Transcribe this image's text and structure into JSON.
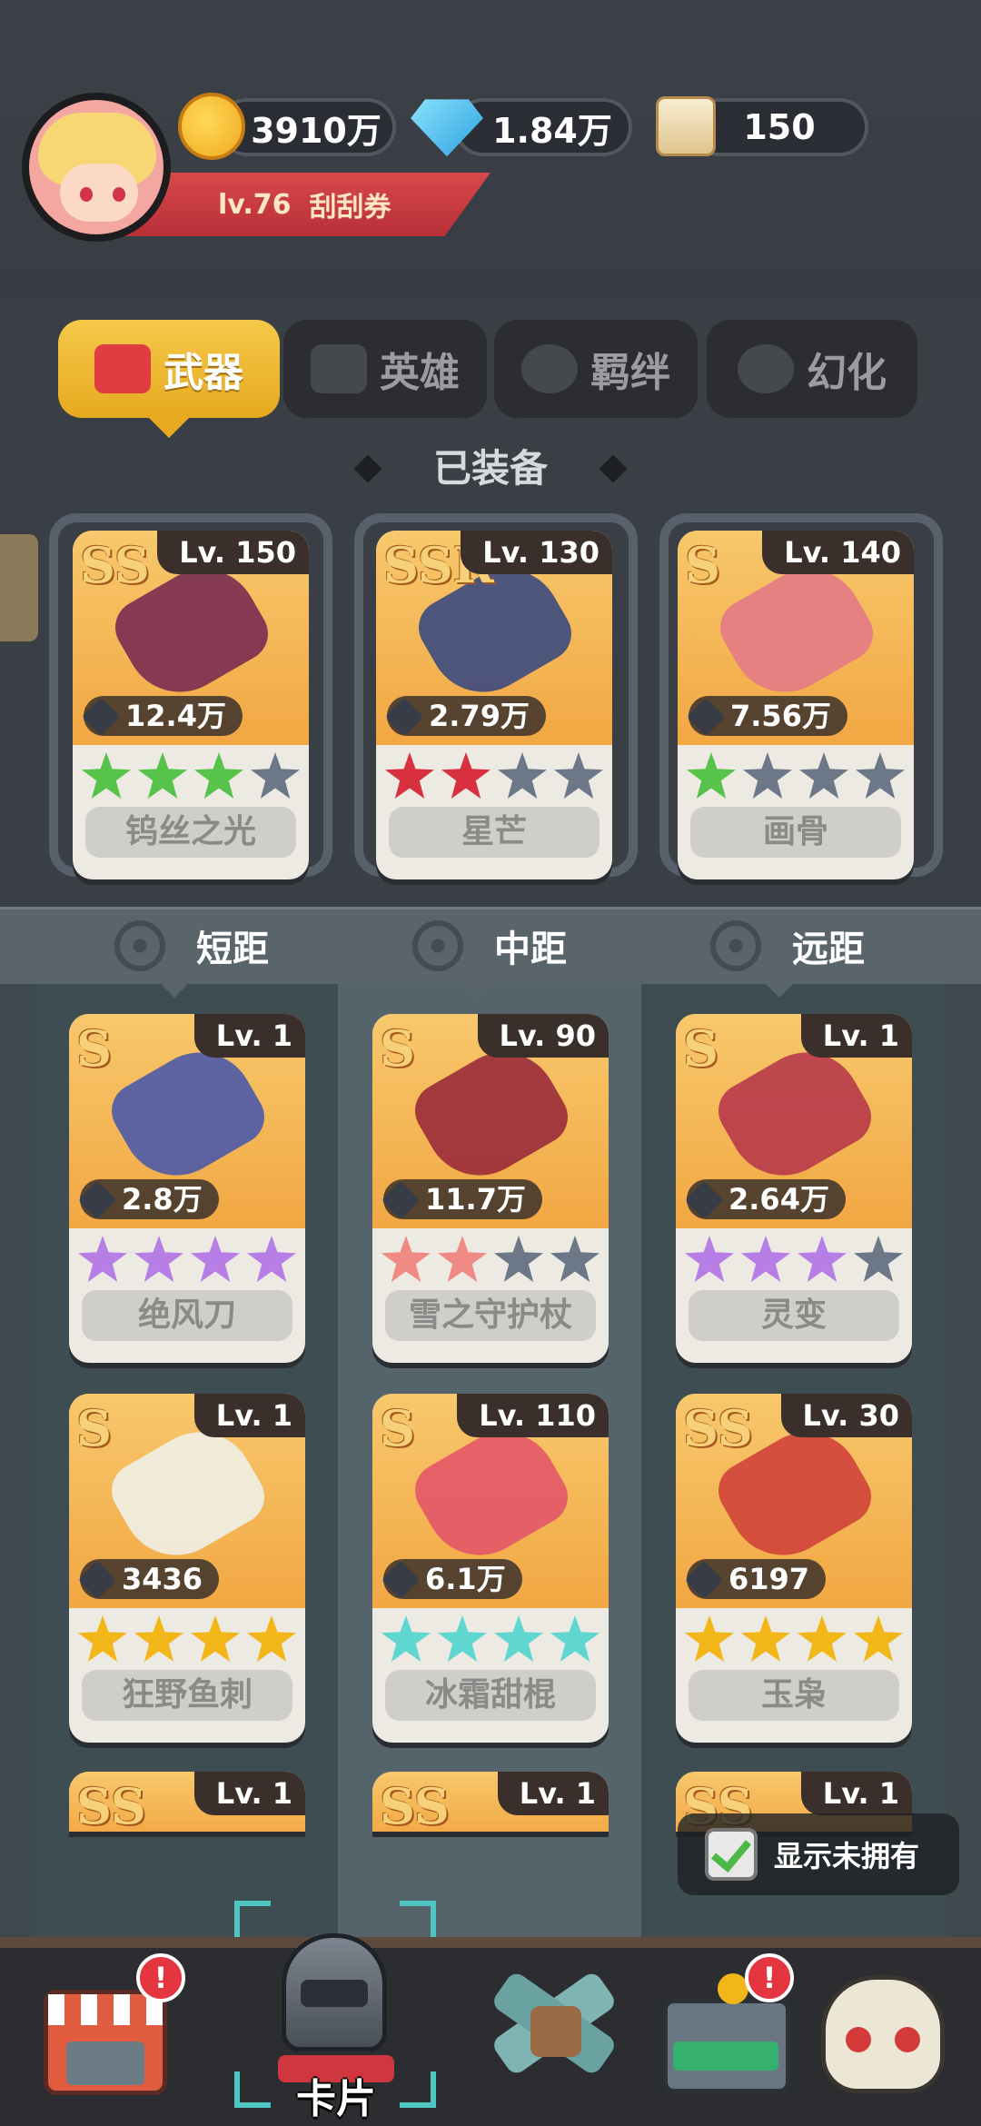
{
  "player": {
    "level": "lv.76",
    "title": "刮刮券"
  },
  "resources": {
    "gold": "3910万",
    "diamonds": "1.84万",
    "scrolls": "150"
  },
  "tabs": [
    {
      "label": "武器"
    },
    {
      "label": "英雄"
    },
    {
      "label": "羁绊"
    },
    {
      "label": "幻化"
    }
  ],
  "equipped_title": "已装备",
  "equipped": [
    {
      "rarity": "SS",
      "level": "Lv. 150",
      "power": "12.4万",
      "name": "钨丝之光",
      "stars": [
        "#57c34a",
        "#57c34a",
        "#57c34a",
        "#6c7887"
      ]
    },
    {
      "rarity": "SSR",
      "level": "Lv. 130",
      "power": "2.79万",
      "name": "星芒",
      "stars": [
        "#d93040",
        "#d93040",
        "#6c7887",
        "#6c7887"
      ]
    },
    {
      "rarity": "S",
      "level": "Lv. 140",
      "power": "7.56万",
      "name": "画骨",
      "stars": [
        "#57c34a",
        "#6c7887",
        "#6c7887",
        "#6c7887"
      ]
    }
  ],
  "ranges": [
    {
      "label": "短距"
    },
    {
      "label": "中距"
    },
    {
      "label": "远距"
    }
  ],
  "weapons": [
    {
      "rarity": "S",
      "level": "Lv. 1",
      "power": "2.8万",
      "name": "绝风刀",
      "stars": [
        "#b77ee6",
        "#b77ee6",
        "#b77ee6",
        "#b77ee6"
      ]
    },
    {
      "rarity": "S",
      "level": "Lv. 90",
      "power": "11.7万",
      "name": "雪之守护杖",
      "stars": [
        "#f08a84",
        "#f08a84",
        "#6c7887",
        "#6c7887"
      ]
    },
    {
      "rarity": "S",
      "level": "Lv. 1",
      "power": "2.64万",
      "name": "灵变",
      "stars": [
        "#b77ee6",
        "#b77ee6",
        "#b77ee6",
        "#6c7887"
      ]
    },
    {
      "rarity": "S",
      "level": "Lv. 1",
      "power": "3436",
      "name": "狂野鱼刺",
      "stars": [
        "#f2b619",
        "#f2b619",
        "#f2b619",
        "#f2b619"
      ]
    },
    {
      "rarity": "S",
      "level": "Lv. 110",
      "power": "6.1万",
      "name": "冰霜甜棍",
      "stars": [
        "#5fd6d0",
        "#5fd6d0",
        "#5fd6d0",
        "#5fd6d0"
      ]
    },
    {
      "rarity": "SS",
      "level": "Lv. 30",
      "power": "6197",
      "name": "玉枭",
      "stars": [
        "#f2b619",
        "#f2b619",
        "#f2b619",
        "#f2b619"
      ]
    },
    {
      "rarity": "SS",
      "level": "Lv. 1"
    },
    {
      "rarity": "SS",
      "level": "Lv. 1"
    },
    {
      "rarity": "SS",
      "level": "Lv. 1"
    }
  ],
  "toggle": {
    "label": "显示未拥有",
    "checked": true
  },
  "nav": {
    "active_label": "卡片",
    "badge_text": "!"
  }
}
